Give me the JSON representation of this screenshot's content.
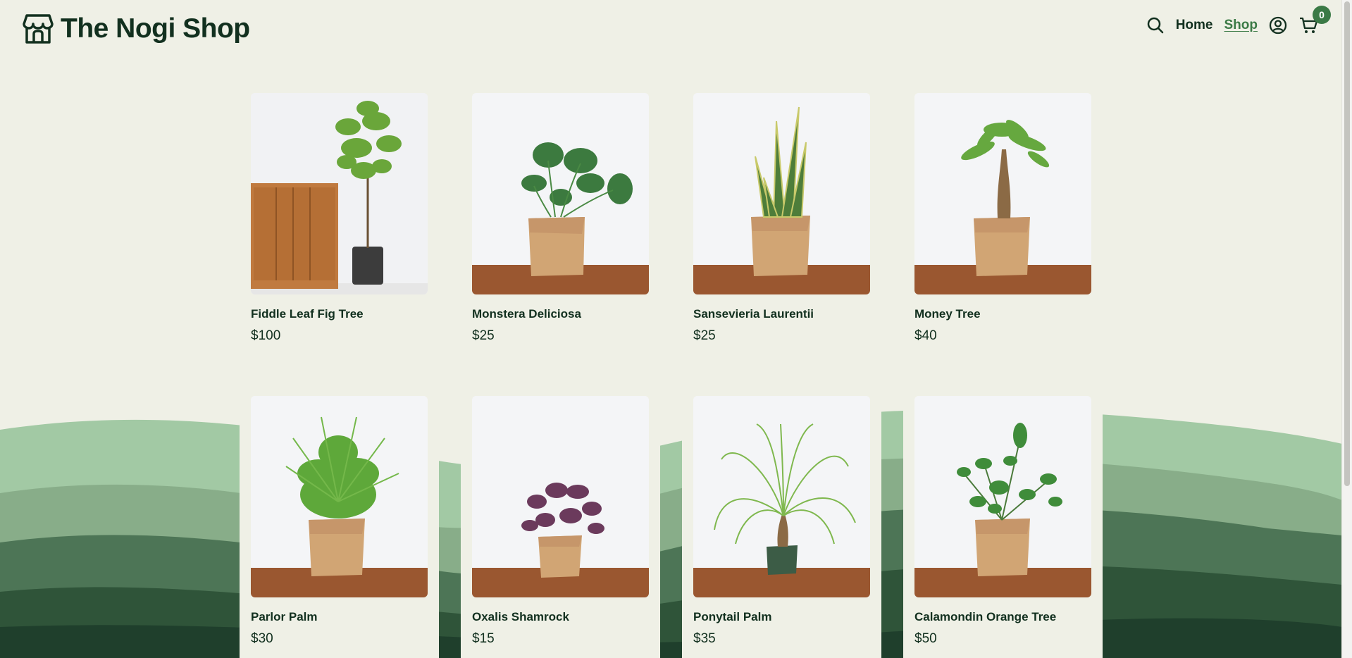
{
  "header": {
    "brand": "The Nogi Shop",
    "nav": {
      "home": "Home",
      "shop": "Shop",
      "cart_count": "0"
    },
    "icons": [
      "storefront-icon",
      "search-icon",
      "account-icon",
      "cart-icon"
    ]
  },
  "products": [
    {
      "name": "Fiddle Leaf Fig Tree",
      "price": "$100"
    },
    {
      "name": "Monstera Deliciosa",
      "price": "$25"
    },
    {
      "name": "Sansevieria Laurentii",
      "price": "$25"
    },
    {
      "name": "Money Tree",
      "price": "$40"
    },
    {
      "name": "Parlor Palm",
      "price": "$30"
    },
    {
      "name": "Oxalis Shamrock",
      "price": "$15"
    },
    {
      "name": "Ponytail Palm",
      "price": "$35"
    },
    {
      "name": "Calamondin Orange Tree",
      "price": "$50"
    }
  ],
  "colors": {
    "background": "#eff0e6",
    "brand_text": "#12301f",
    "accent": "#3b7a46",
    "hill_light": "#a2c9a4",
    "hill_mid": "#88ad89",
    "hill_dark": "#4d7556",
    "hill_darkest": "#1f3f2c"
  }
}
